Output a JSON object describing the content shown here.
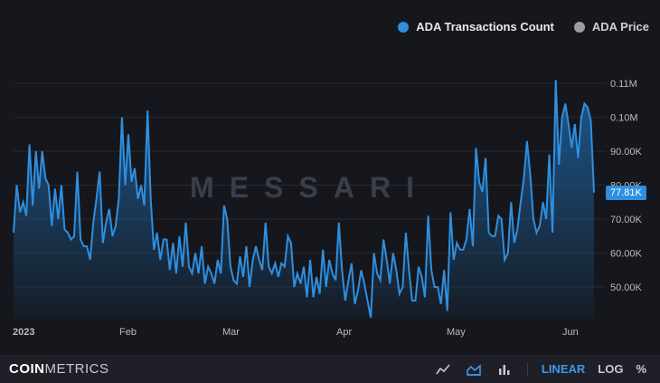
{
  "legend": {
    "series1": "ADA Transactions Count",
    "series2": "ADA Price"
  },
  "watermark": "MESSARI",
  "last_value_badge": "77.81K",
  "footer": {
    "brand_bold": "COIN",
    "brand_rest": "METRICS",
    "scale_linear": "LINEAR",
    "scale_log": "LOG",
    "scale_percent": "%"
  },
  "colors": {
    "line": "#2e8fe0",
    "area_top": "#1f6fb8",
    "background": "#16171c"
  },
  "chart_data": {
    "type": "area",
    "title": "",
    "xlabel": "",
    "ylabel": "",
    "x_ticks": [
      "2023",
      "Feb",
      "Mar",
      "Apr",
      "May",
      "Jun"
    ],
    "y_ticks": [
      "50.00K",
      "60.00K",
      "70.00K",
      "80.00K",
      "90.00K",
      "0.10M",
      "0.11M"
    ],
    "ylim": [
      41000,
      112000
    ],
    "grid": true,
    "legend_position": "top-right",
    "series": [
      {
        "name": "ADA Transactions Count",
        "values": [
          66000,
          80000,
          72000,
          75000,
          71000,
          92000,
          74000,
          90000,
          79000,
          90000,
          82000,
          80000,
          68000,
          79000,
          70000,
          80000,
          67000,
          66000,
          64000,
          65000,
          84000,
          64000,
          62000,
          62000,
          58000,
          69000,
          76000,
          84000,
          63000,
          69000,
          73000,
          65000,
          68000,
          76000,
          100000,
          80000,
          95000,
          81000,
          85000,
          76000,
          80000,
          74000,
          102000,
          76000,
          61000,
          66000,
          58000,
          64000,
          64000,
          55000,
          63000,
          54000,
          65000,
          56000,
          69000,
          56000,
          54000,
          60000,
          54000,
          62000,
          51000,
          56000,
          54000,
          51000,
          58000,
          54000,
          74000,
          70000,
          56000,
          52000,
          51000,
          59000,
          53000,
          62000,
          50000,
          58000,
          62000,
          58000,
          55000,
          69000,
          56000,
          54000,
          57000,
          53000,
          57000,
          56000,
          65000,
          63000,
          50000,
          54000,
          51000,
          56000,
          47000,
          58000,
          47000,
          53000,
          48000,
          61000,
          50000,
          58000,
          54000,
          52000,
          69000,
          55000,
          46000,
          52000,
          57000,
          45000,
          49000,
          55000,
          51000,
          46000,
          41000,
          60000,
          54000,
          52000,
          64000,
          58000,
          51000,
          60000,
          55000,
          48000,
          50000,
          66000,
          55000,
          46000,
          46000,
          56000,
          53000,
          47000,
          71000,
          55000,
          50000,
          50000,
          45000,
          55000,
          43000,
          72000,
          58000,
          63000,
          61000,
          61000,
          64000,
          73000,
          62000,
          91000,
          81000,
          78000,
          88000,
          66000,
          65000,
          65000,
          71000,
          70000,
          58000,
          60000,
          75000,
          63000,
          67000,
          75000,
          82000,
          93000,
          83000,
          70000,
          66000,
          68000,
          75000,
          70000,
          89000,
          66000,
          111000,
          86000,
          100000,
          104000,
          98000,
          91000,
          98000,
          88000,
          100000,
          104000,
          103000,
          99000,
          77810
        ]
      }
    ]
  }
}
